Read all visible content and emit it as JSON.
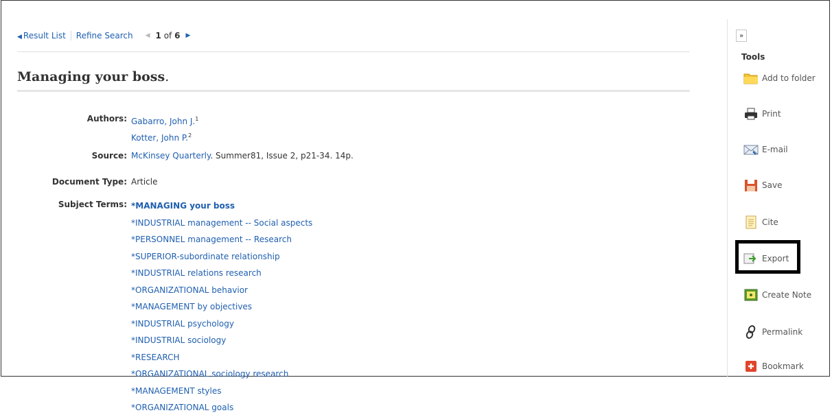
{
  "nav": {
    "result_list": "Result List",
    "refine_search": "Refine Search",
    "pager_current": "1",
    "pager_of": "of",
    "pager_total": "6"
  },
  "record": {
    "title": "Managing your boss",
    "title_suffix": ".",
    "authors_label": "Authors:",
    "authors": [
      {
        "name": "Gabarro, John J.",
        "sup": "1"
      },
      {
        "name": "Kotter, John P.",
        "sup": "2"
      }
    ],
    "source_label": "Source:",
    "source_link": "McKinsey Quarterly",
    "source_rest": ". Summer81, Issue 2, p21-34. 14p.",
    "doctype_label": "Document Type:",
    "doctype": "Article",
    "subjects_label": "Subject Terms:",
    "subjects": [
      "*MANAGING your boss",
      "*INDUSTRIAL management -- Social aspects",
      "*PERSONNEL management -- Research",
      "*SUPERIOR-subordinate relationship",
      "*INDUSTRIAL relations research",
      "*ORGANIZATIONAL behavior",
      "*MANAGEMENT by objectives",
      "*INDUSTRIAL psychology",
      "*INDUSTRIAL sociology",
      "*RESEARCH",
      "*ORGANIZATIONAL sociology research",
      "*MANAGEMENT styles",
      "*ORGANIZATIONAL goals"
    ]
  },
  "tools": {
    "title": "Tools",
    "collapse": "»",
    "items": [
      {
        "label": "Add to folder",
        "icon": "folder-icon"
      },
      {
        "label": "Print",
        "icon": "printer-icon"
      },
      {
        "label": "E-mail",
        "icon": "email-icon"
      },
      {
        "label": "Save",
        "icon": "save-icon"
      },
      {
        "label": "Cite",
        "icon": "cite-icon"
      },
      {
        "label": "Export",
        "icon": "export-icon"
      },
      {
        "label": "Create Note",
        "icon": "note-icon"
      },
      {
        "label": "Permalink",
        "icon": "link-icon"
      },
      {
        "label": "Bookmark",
        "icon": "bookmark-icon"
      }
    ]
  },
  "colors": {
    "link": "#1f5fb0",
    "text": "#333333",
    "highlight_border": "#000000"
  }
}
